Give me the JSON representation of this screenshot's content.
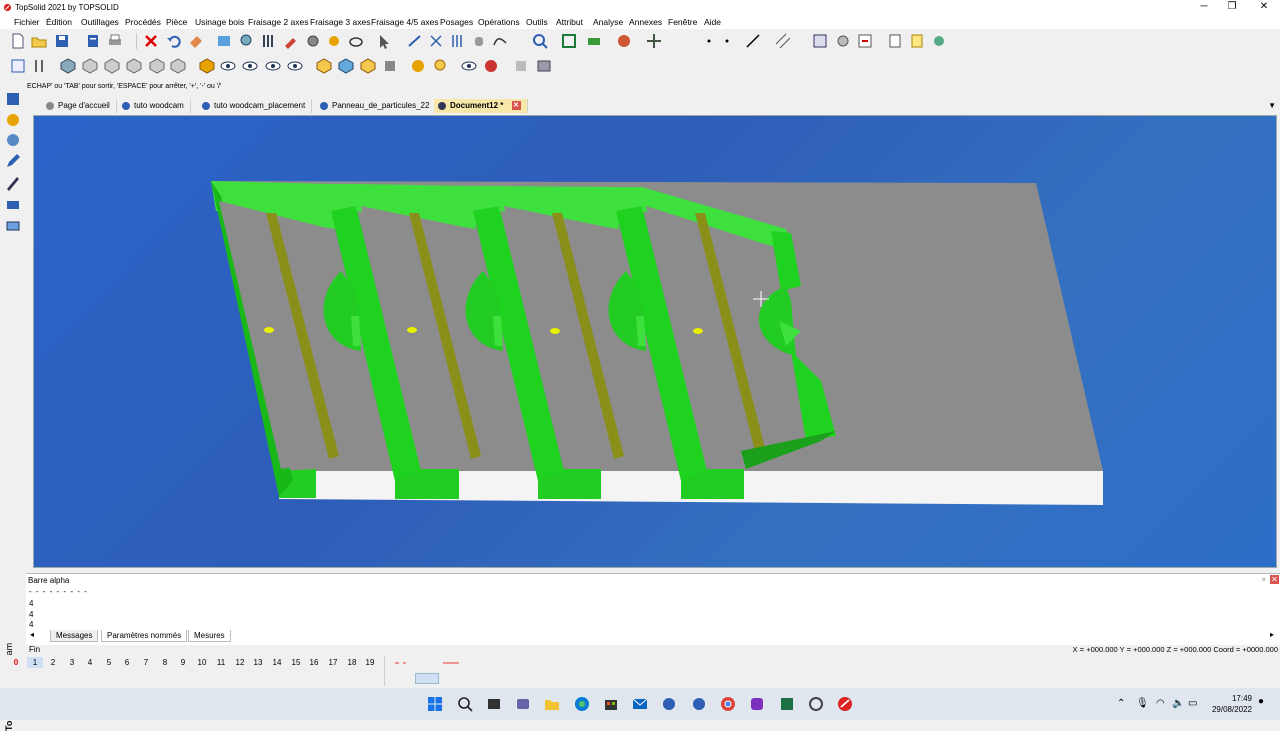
{
  "window": {
    "title": "TopSolid 2021 by TOPSOLID",
    "minimize": "─",
    "maximize": "❐",
    "close": "✕"
  },
  "menu": [
    "Fichier",
    "Édition",
    "Outillages",
    "Procédés",
    "Pièce",
    "Usinage bois",
    "Fraisage 2 axes",
    "Fraisage 3 axes",
    "Fraisage 4/5 axes",
    "Posages",
    "Opérations",
    "Outils",
    "Attribut",
    "Analyse",
    "Annexes",
    "Fenêtre",
    "Aide"
  ],
  "hint": "ECHAP' ou 'TAB' pour sortir, 'ESPACE' pour arrêter, '+', '-' ou '/'",
  "tabs": [
    {
      "label": "Page d'accueil",
      "active": false
    },
    {
      "label": "tuto woodcam",
      "active": false
    },
    {
      "label": "tuto woodcam_placement",
      "active": false
    },
    {
      "label": "Panneau_de_particules_22",
      "active": false
    },
    {
      "label": "Document12 *",
      "active": true
    }
  ],
  "sidebar_label": {
    "main": "TopSolid",
    "sub": " - WoodCam"
  },
  "bottom_panel": {
    "title": "Barre alpha",
    "dashes": "- - - - - - - - -",
    "lines": [
      "4",
      "4",
      "4"
    ],
    "tabs": [
      "Messages",
      "Paramètres nommés",
      "Mesures"
    ]
  },
  "status": {
    "text": "Fin",
    "coords": "X = +000.000  Y = +000.000  Z = +000.000  Coord = +0000.000"
  },
  "layers": [
    "0",
    "1",
    "2",
    "3",
    "4",
    "5",
    "6",
    "7",
    "8",
    "9",
    "10",
    "11",
    "12",
    "13",
    "14",
    "15",
    "16",
    "17",
    "18",
    "19"
  ],
  "taskbar": {
    "time": "17:49",
    "date": "29/08/2022"
  },
  "colors": {
    "viewport_bg": "#2b64c9",
    "part_grey": "#8c8c8c",
    "part_green": "#1fd21f",
    "edge_white": "#f4f4f4",
    "groove_olive": "#8a8f1a"
  }
}
